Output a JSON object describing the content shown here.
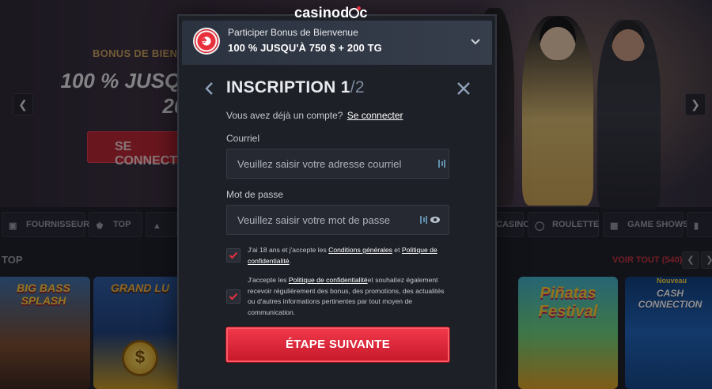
{
  "header": {
    "logo_text_1": "casinod",
    "logo_text_2": "c"
  },
  "hero": {
    "subtitle": "BONUS DE BIENVENU",
    "title_line_1": "100 % JUSQU'À",
    "title_line_2": "200 T",
    "cta_label": "SE CONNECT"
  },
  "categories": [
    {
      "label": "FOURNISSEURS",
      "icon": "provider-icon"
    },
    {
      "label": "TOP",
      "icon": "crown-icon"
    },
    {
      "label": "CASINO",
      "icon": "casino-icon"
    },
    {
      "label": "ROULETTE",
      "icon": "roulette-icon"
    },
    {
      "label": "GAME SHOWS",
      "icon": "gameshow-icon"
    }
  ],
  "section": {
    "title": "TOP",
    "see_all": "VOIR TOUT (540)"
  },
  "tiles": [
    {
      "title": "BIG BASS SPLASH"
    },
    {
      "title": "GRAND LU"
    },
    {
      "title": "Piñatas Festival"
    },
    {
      "badge": "Nouveau",
      "title": "CASH CONNECTION"
    }
  ],
  "modal": {
    "bonus": {
      "label": "Participer Bonus de Bienvenue",
      "value": "100 % JUSQU'À 750 $ + 200 TG"
    },
    "title": "INSCRIPTION",
    "step_current": "1",
    "step_total": "/2",
    "login_prompt": "Vous avez déjà un compte?",
    "login_link": "Se connecter",
    "email": {
      "label": "Courriel",
      "placeholder": "Veuillez saisir votre adresse courriel",
      "value": ""
    },
    "password": {
      "label": "Mot de passe",
      "placeholder": "Veuillez saisir votre mot de passe",
      "value": ""
    },
    "consent_terms": {
      "checked": true,
      "text_1": "J'ai 18 ans et j'accepte les ",
      "link_1": "Conditions générales",
      "text_2": " et ",
      "link_2": "Politique de confidentialité",
      "text_3": "."
    },
    "consent_marketing": {
      "checked": true,
      "text_1": "J'accepte les ",
      "link_1": "Politique de confidentialité",
      "text_2": "et souhaitez également recevoir régulièrement des bonus, des promotions, des actualités ou d'autres informations pertinentes par tout moyen de communication."
    },
    "next_button": "ÉTAPE SUIVANTE"
  },
  "colors": {
    "accent": "#e8303c",
    "modal_bg": "#1d2027",
    "input_bg": "#262932"
  }
}
